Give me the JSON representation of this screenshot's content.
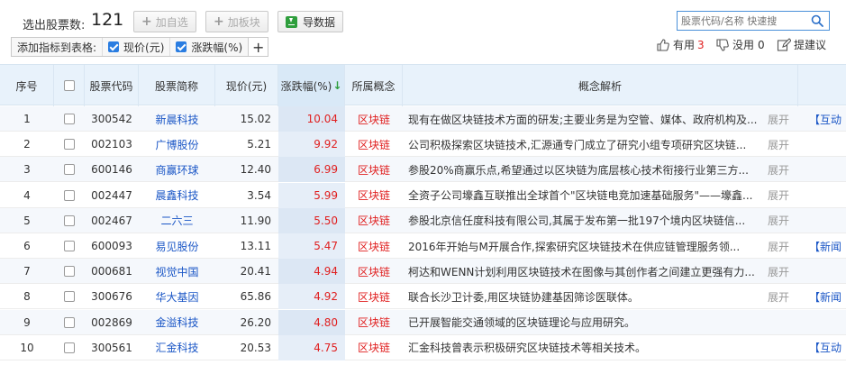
{
  "toolbar": {
    "count_label": "选出股票数:",
    "count_value": "121",
    "add_watch_label": "加自选",
    "add_sector_label": "加板块",
    "export_label": "导数据",
    "add_indicator_label": "添加指标到表格:",
    "indicators": [
      {
        "label": "现价(元)",
        "checked": true
      },
      {
        "label": "涨跌幅(%)",
        "checked": true
      }
    ],
    "add_plus": "+"
  },
  "search": {
    "placeholder": "股票代码/名称 快速搜"
  },
  "feedback": {
    "useful_label": "有用",
    "useful_count": "3",
    "useless_label": "没用",
    "useless_count": "0",
    "suggest_label": "提建议"
  },
  "table": {
    "headers": {
      "seq": "序号",
      "code": "股票代码",
      "name": "股票简称",
      "price": "现价(元)",
      "change": "涨跌幅(%)",
      "sort_arrow": "↓",
      "concept": "所属概念",
      "analysis": "概念解析"
    },
    "rows": [
      {
        "seq": "1",
        "code": "300542",
        "name": "新晨科技",
        "price": "15.02",
        "change": "10.04",
        "concept": "区块链",
        "analysis": "现有在做区块链技术方面的研发;主要业务是为空管、媒体、政府机构及...",
        "expand": "展开",
        "tag": "【互动"
      },
      {
        "seq": "2",
        "code": "002103",
        "name": "广博股份",
        "price": "5.21",
        "change": "9.92",
        "concept": "区块链",
        "analysis": "公司积极探索区块链技术,汇源通专门成立了研究小组专项研究区块链...",
        "expand": "展开",
        "tag": ""
      },
      {
        "seq": "3",
        "code": "600146",
        "name": "商赢环球",
        "price": "12.40",
        "change": "6.99",
        "concept": "区块链",
        "analysis": "参股20%商赢乐点,希望通过以区块链为底层核心技术衔接行业第三方...",
        "expand": "展开",
        "tag": ""
      },
      {
        "seq": "4",
        "code": "002447",
        "name": "晨鑫科技",
        "price": "3.54",
        "change": "5.99",
        "concept": "区块链",
        "analysis": "全资子公司壕鑫互联推出全球首个\"区块链电竞加速基础服务\"——壕鑫...",
        "expand": "展开",
        "tag": ""
      },
      {
        "seq": "5",
        "code": "002467",
        "name": "二六三",
        "price": "11.90",
        "change": "5.50",
        "concept": "区块链",
        "analysis": "参股北京信任度科技有限公司,其属于发布第一批197个境内区块链信...",
        "expand": "展开",
        "tag": ""
      },
      {
        "seq": "6",
        "code": "600093",
        "name": "易见股份",
        "price": "13.11",
        "change": "5.47",
        "concept": "区块链",
        "analysis": "2016年开始与M开展合作,探索研究区块链技术在供应链管理服务领...",
        "expand": "展开",
        "tag": "【新闻"
      },
      {
        "seq": "7",
        "code": "000681",
        "name": "视觉中国",
        "price": "20.41",
        "change": "4.94",
        "concept": "区块链",
        "analysis": "柯达和WENN计划利用区块链技术在图像与其创作者之间建立更强有力...",
        "expand": "展开",
        "tag": ""
      },
      {
        "seq": "8",
        "code": "300676",
        "name": "华大基因",
        "price": "65.86",
        "change": "4.92",
        "concept": "区块链",
        "analysis": "联合长沙卫计委,用区块链协建基因筛诊医联体。",
        "expand": "展开",
        "tag": "【新闻"
      },
      {
        "seq": "9",
        "code": "002869",
        "name": "金溢科技",
        "price": "26.20",
        "change": "4.80",
        "concept": "区块链",
        "analysis": "已开展智能交通领域的区块链理论与应用研究。",
        "expand": "",
        "tag": ""
      },
      {
        "seq": "10",
        "code": "300561",
        "name": "汇金科技",
        "price": "20.53",
        "change": "4.75",
        "concept": "区块链",
        "analysis": "汇金科技曾表示积极研究区块链技术等相关技术。",
        "expand": "",
        "tag": "【互动"
      }
    ]
  },
  "colors": {
    "accent": "#4a90d9",
    "up_red": "#e02020",
    "link_blue": "#1a56c6",
    "sort_green": "#2e9e3c"
  }
}
